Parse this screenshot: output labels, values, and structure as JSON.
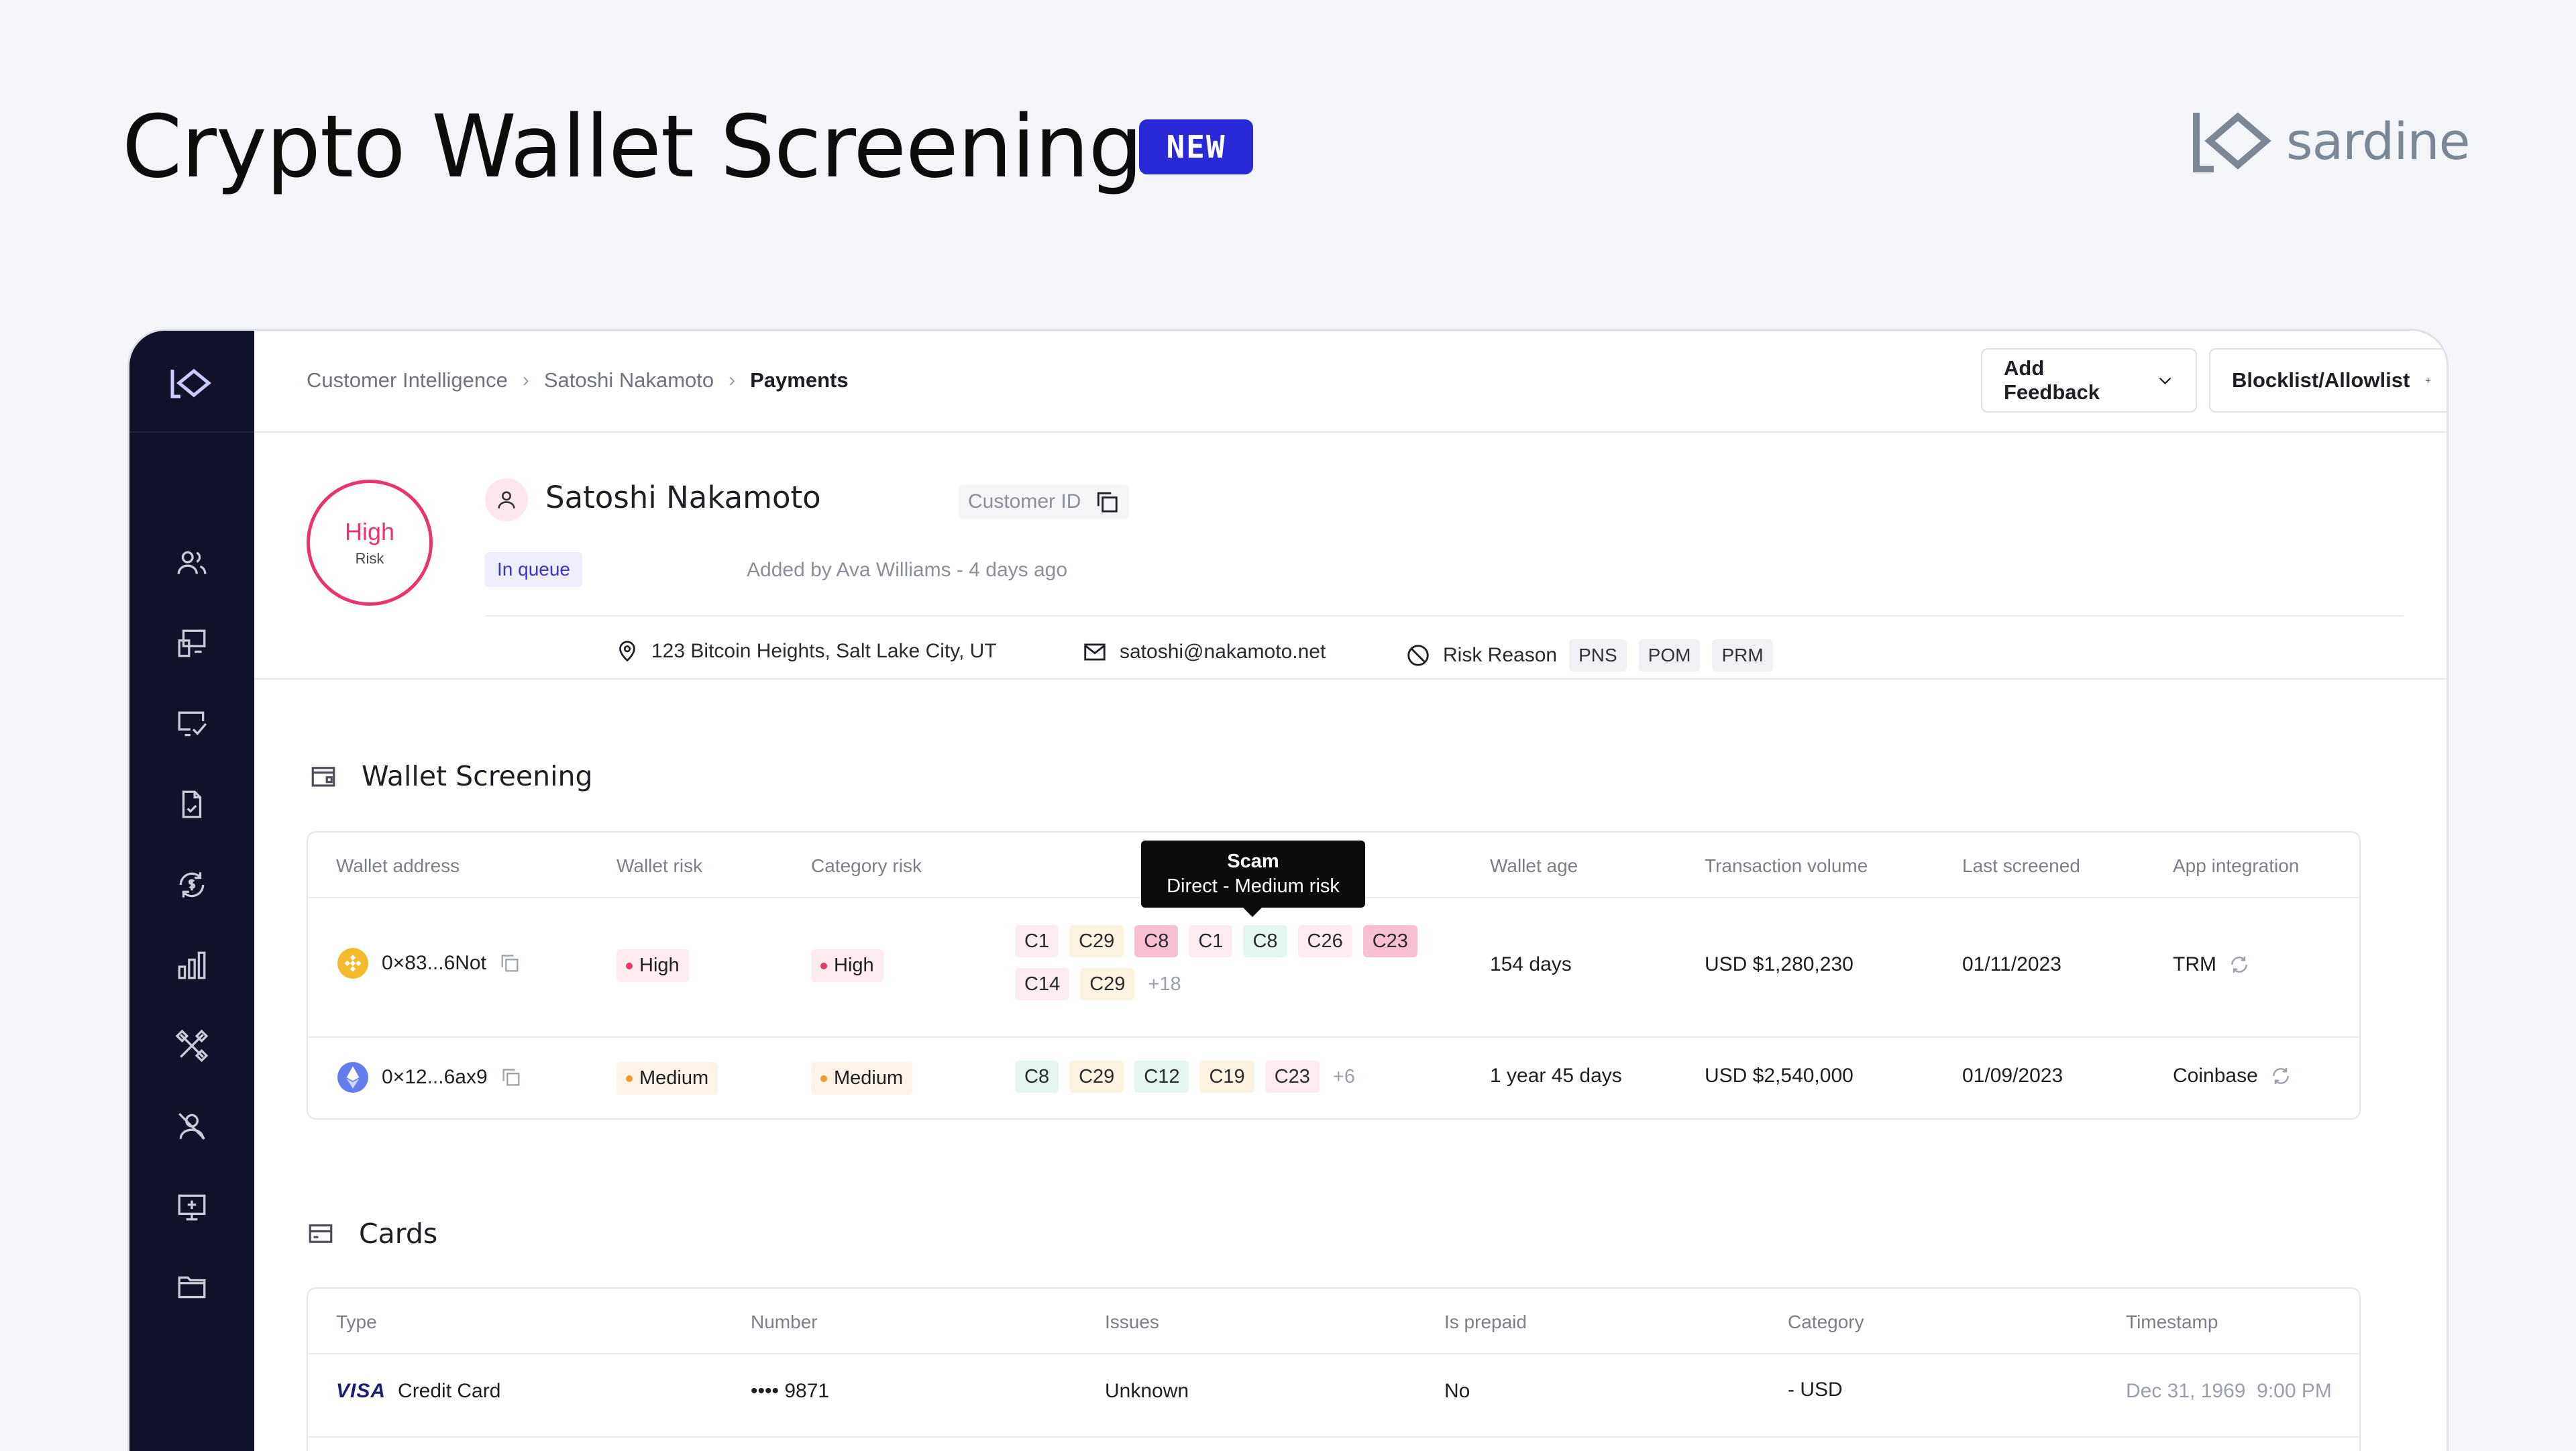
{
  "hero": {
    "title": "Crypto Wallet Screening",
    "badge": "NEW",
    "brand": "sardine"
  },
  "breadcrumbs": [
    "Customer Intelligence",
    "Satoshi Nakamoto",
    "Payments"
  ],
  "toolbar": {
    "feedback": "Add Feedback",
    "blocklist": "Blocklist/Allowlist"
  },
  "customer": {
    "risk_level": "High",
    "risk_sub": "Risk",
    "name": "Satoshi Nakamoto",
    "id_label": "Customer ID",
    "status": "In queue",
    "added": "Added by Ava Williams - 4 days ago",
    "address": "123 Bitcoin Heights, Salt Lake City, UT",
    "email": "satoshi@nakamoto.net",
    "risk_reason_label": "Risk Reason",
    "risk_reasons": [
      "PNS",
      "POM",
      "PRM"
    ]
  },
  "wallet": {
    "title": "Wallet Screening",
    "headers": [
      "Wallet address",
      "Wallet risk",
      "Category risk",
      "Wallet age",
      "Transaction volume",
      "Last screened",
      "App integration"
    ],
    "tooltip": {
      "title": "Scam",
      "body": "Direct - Medium risk"
    },
    "rows": [
      {
        "address": "0×83...6Not",
        "wallet_risk": "High",
        "category_risk": "High",
        "cats": [
          "C1",
          "C29",
          "C8",
          "C1",
          "C8",
          "C26",
          "C23",
          "C14",
          "C29"
        ],
        "more": "+18",
        "age": "154 days",
        "volume": "USD $1,280,230",
        "screened": "01/11/2023",
        "app": "TRM"
      },
      {
        "address": "0×12...6ax9",
        "wallet_risk": "Medium",
        "category_risk": "Medium",
        "cats": [
          "C8",
          "C29",
          "C12",
          "C19",
          "C23"
        ],
        "more": "+6",
        "age": "1 year 45 days",
        "volume": "USD $2,540,000",
        "screened": "01/09/2023",
        "app": "Coinbase"
      }
    ]
  },
  "cards": {
    "title": "Cards",
    "headers": [
      "Type",
      "Number",
      "Issues",
      "Is prepaid",
      "Category",
      "Timestamp"
    ],
    "rows": [
      {
        "brand": "VISA",
        "type": "Credit Card",
        "number": "•••• 9871",
        "issues": "Unknown",
        "prepaid": "No",
        "category": "- USD",
        "timestamp": "Dec 31, 1969  9:00 PM"
      }
    ]
  },
  "colors": {
    "accent": "#2a29d8",
    "sidebar": "#11112a",
    "high": "#e8356a",
    "medium": "#f29a2e"
  }
}
